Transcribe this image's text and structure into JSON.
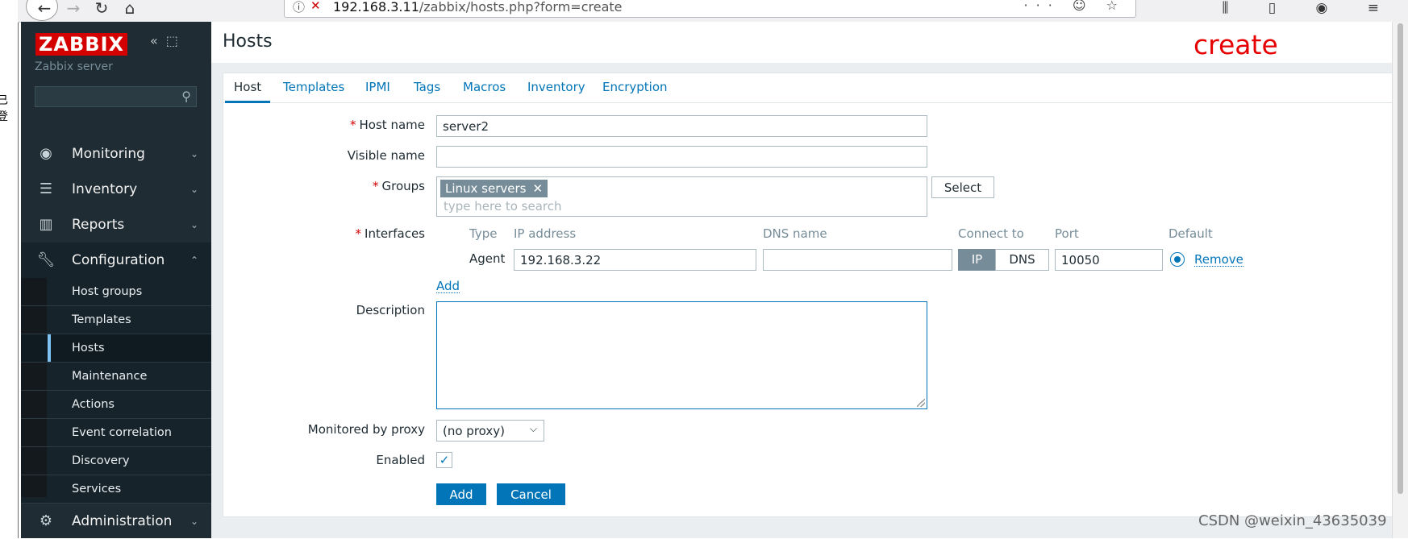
{
  "browser": {
    "url_host": "192.168.3.11",
    "url_path": "/zabbix/hosts.php?form=create"
  },
  "left_strip_text": "已登",
  "sidebar": {
    "logo": "ZABBIX",
    "server": "Zabbix server",
    "menu": [
      {
        "label": "Monitoring",
        "icon": "eye-icon"
      },
      {
        "label": "Inventory",
        "icon": "list-icon"
      },
      {
        "label": "Reports",
        "icon": "bar-chart-icon"
      },
      {
        "label": "Configuration",
        "icon": "wrench-icon"
      },
      {
        "label": "Administration",
        "icon": "gear-icon"
      }
    ],
    "config_sub": [
      "Host groups",
      "Templates",
      "Hosts",
      "Maintenance",
      "Actions",
      "Event correlation",
      "Discovery",
      "Services"
    ]
  },
  "page": {
    "title": "Hosts",
    "annotation": "create"
  },
  "tabs": [
    "Host",
    "Templates",
    "IPMI",
    "Tags",
    "Macros",
    "Inventory",
    "Encryption"
  ],
  "form": {
    "host_name_label": "Host name",
    "host_name_value": "server2",
    "visible_name_label": "Visible name",
    "visible_name_value": "",
    "groups_label": "Groups",
    "group_tag": "Linux servers",
    "groups_placeholder": "type here to search",
    "select_button": "Select",
    "interfaces_label": "Interfaces",
    "iface_headers": {
      "type": "Type",
      "ip": "IP address",
      "dns": "DNS name",
      "connect": "Connect to",
      "port": "Port",
      "default": "Default"
    },
    "iface_row": {
      "type": "Agent",
      "ip": "192.168.3.22",
      "dns": "",
      "conn_ip": "IP",
      "conn_dns": "DNS",
      "port": "10050",
      "remove": "Remove"
    },
    "add_link": "Add",
    "description_label": "Description",
    "proxy_label": "Monitored by proxy",
    "proxy_value": "(no proxy)",
    "enabled_label": "Enabled",
    "add_button": "Add",
    "cancel_button": "Cancel"
  },
  "watermark": "CSDN @weixin_43635039",
  "colors": {
    "accent": "#0275b8",
    "sidebar": "#1f2c33",
    "brand": "#d40000",
    "annotation": "#e60000"
  }
}
